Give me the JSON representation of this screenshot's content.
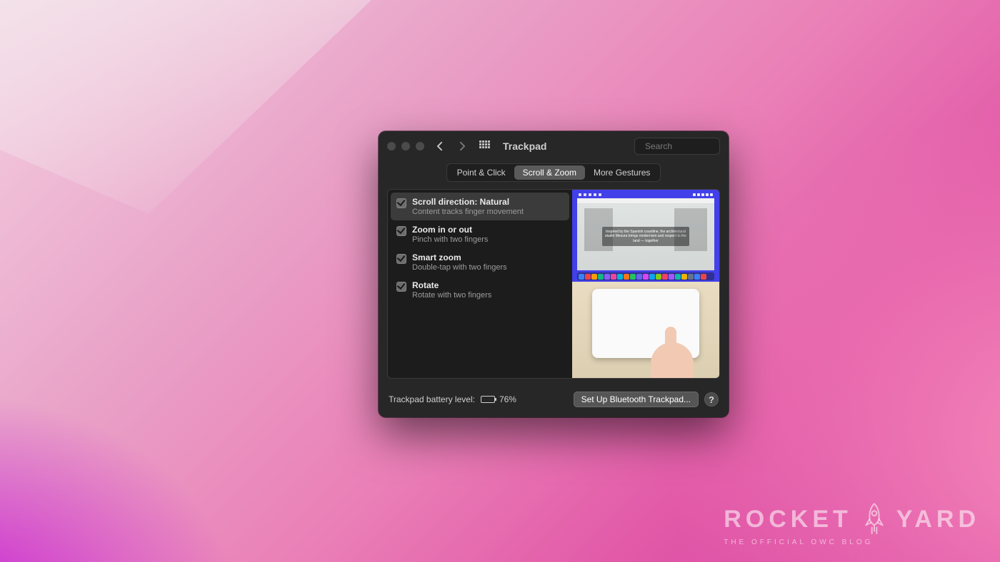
{
  "window": {
    "title": "Trackpad",
    "search_placeholder": "Search"
  },
  "tabs": [
    {
      "label": "Point & Click",
      "active": false
    },
    {
      "label": "Scroll & Zoom",
      "active": true
    },
    {
      "label": "More Gestures",
      "active": false
    }
  ],
  "options": [
    {
      "title": "Scroll direction: Natural",
      "desc": "Content tracks finger movement",
      "checked": true,
      "selected": true
    },
    {
      "title": "Zoom in or out",
      "desc": "Pinch with two fingers",
      "checked": true,
      "selected": false
    },
    {
      "title": "Smart zoom",
      "desc": "Double-tap with two fingers",
      "checked": true,
      "selected": false
    },
    {
      "title": "Rotate",
      "desc": "Rotate with two fingers",
      "checked": true,
      "selected": false
    }
  ],
  "footer": {
    "battery_label": "Trackpad battery level:",
    "battery_percent": "76%",
    "setup_button": "Set Up Bluetooth Trackpad...",
    "help": "?"
  },
  "watermark": {
    "line1a": "ROCKET",
    "line1b": "YARD",
    "line2": "THE OFFICIAL      OWC BLOG"
  }
}
